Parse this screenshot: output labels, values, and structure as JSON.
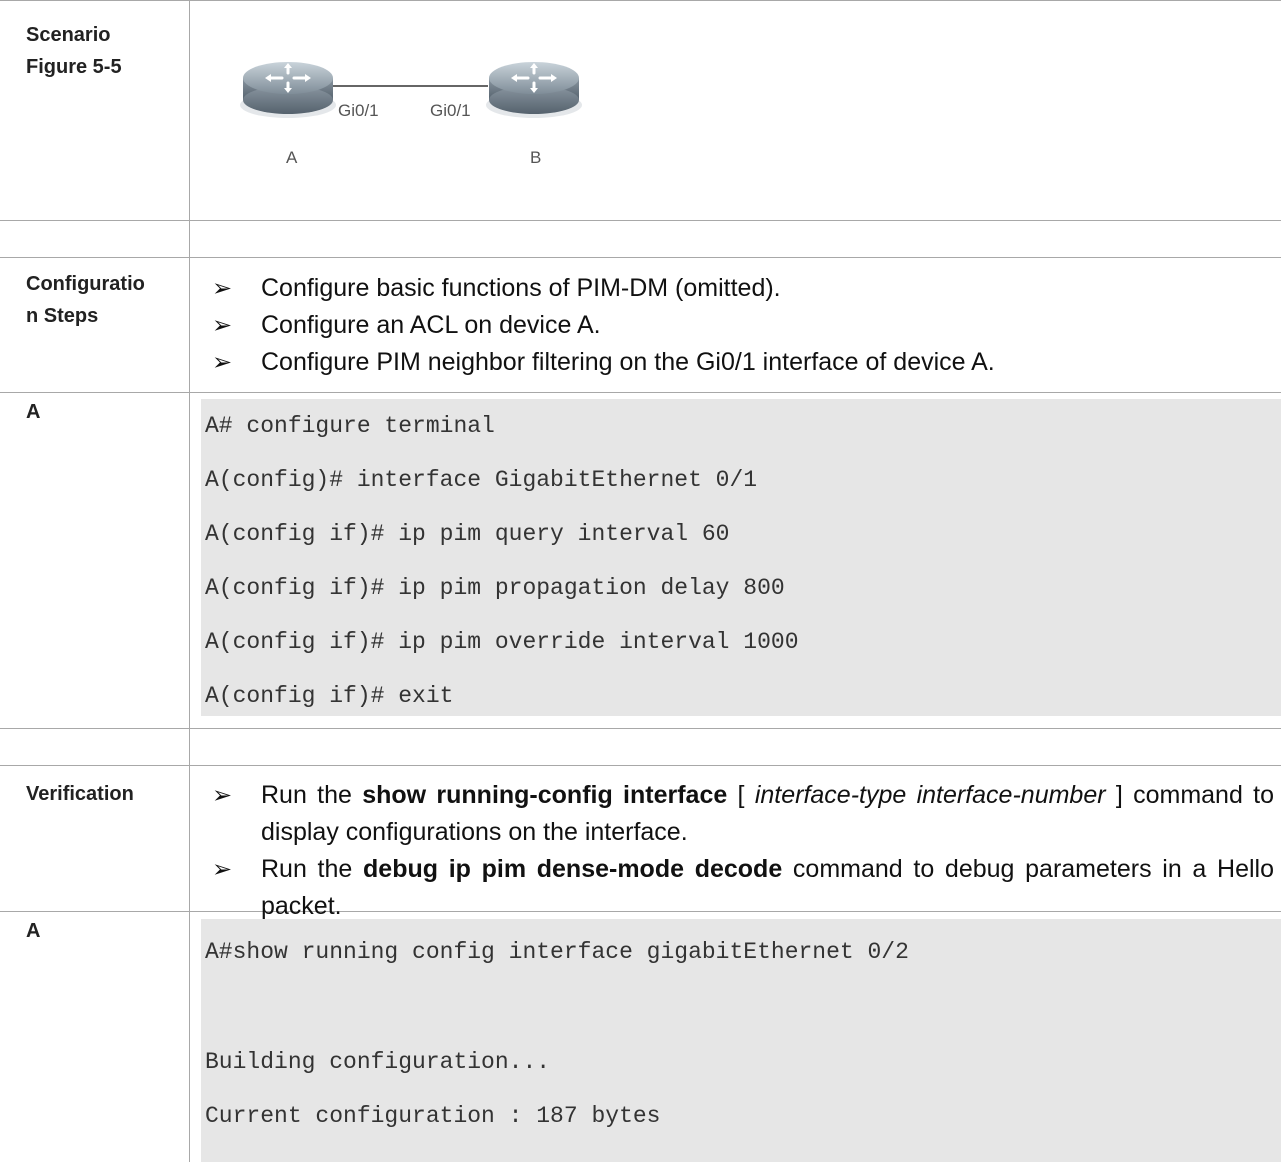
{
  "scenario": {
    "label_line1": "Scenario",
    "label_line2": "Figure 5-5",
    "diagram": {
      "device_a": "A",
      "device_b": "B",
      "port_a": "Gi0/1",
      "port_b": "Gi0/1"
    }
  },
  "config_steps": {
    "label_line1": "Configuratio",
    "label_line2": "n Steps",
    "items": [
      "Configure basic functions of PIM-DM (omitted).",
      "Configure an ACL on device A.",
      "Configure PIM neighbor filtering on the Gi0/1 interface of device A."
    ]
  },
  "config_code": {
    "label": "A",
    "lines": [
      "A# configure terminal",
      "A(config)# interface GigabitEthernet 0/1",
      "A(config if)# ip pim query interval 60",
      "A(config if)# ip pim propagation delay 800",
      "A(config if)# ip pim override interval 1000",
      "A(config if)# exit"
    ]
  },
  "verification": {
    "label": "Verification",
    "item1": {
      "pre": "Run the ",
      "bold": "show running-config interface",
      "mid": " [ ",
      "italic": "interface-type interface-number",
      "post": " ] command to display configurations on the interface."
    },
    "item2": {
      "pre": "Run the ",
      "bold": "debug ip pim dense-mode decode",
      "post": " command to debug parameters in a Hello packet."
    }
  },
  "verify_code": {
    "label": "A",
    "lines": [
      "A#show running config interface gigabitEthernet 0/2",
      "",
      "Building configuration...",
      "Current configuration : 187 bytes"
    ]
  },
  "bullet_glyph": "➢",
  "colors": {
    "code_background": "#e6e6e6",
    "grid_line": "#a8a8a8"
  }
}
